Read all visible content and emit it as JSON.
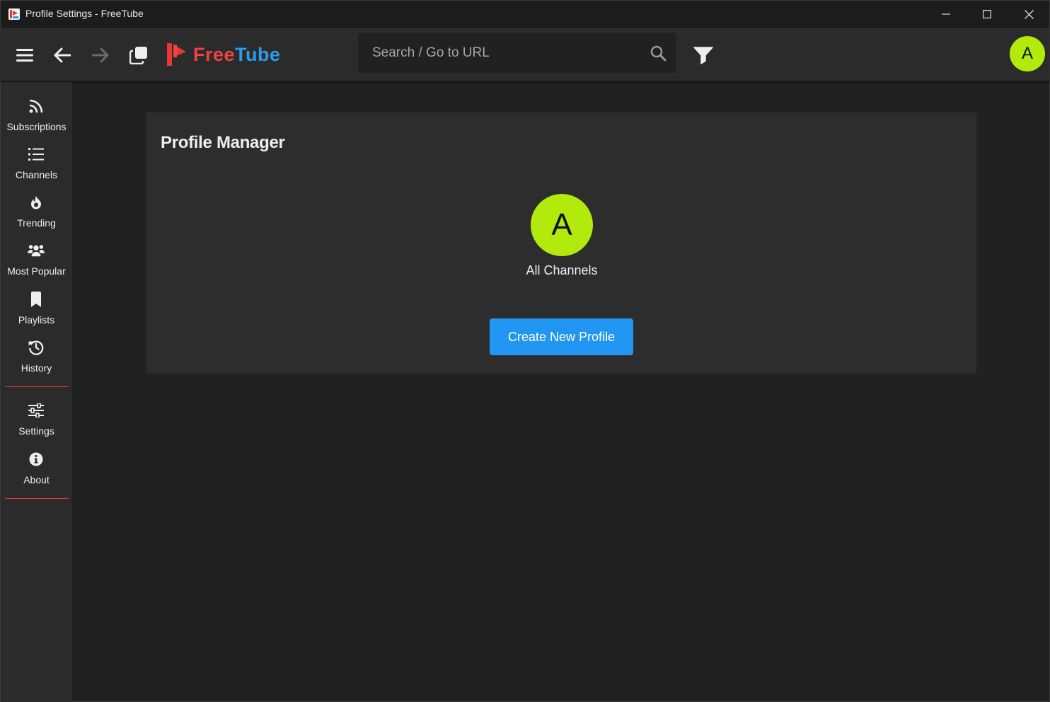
{
  "window": {
    "title": "Profile Settings - FreeTube"
  },
  "topnav": {
    "logo_free": "Free",
    "logo_tube": "Tube",
    "search_placeholder": "Search / Go to URL",
    "avatar_letter": "A"
  },
  "sidebar": {
    "items": [
      {
        "label": "Subscriptions",
        "icon": "rss-icon"
      },
      {
        "label": "Channels",
        "icon": "list-icon"
      },
      {
        "label": "Trending",
        "icon": "fire-icon"
      },
      {
        "label": "Most Popular",
        "icon": "users-icon"
      },
      {
        "label": "Playlists",
        "icon": "bookmark-icon"
      },
      {
        "label": "History",
        "icon": "history-icon"
      },
      {
        "label": "Settings",
        "icon": "sliders-icon"
      },
      {
        "label": "About",
        "icon": "info-icon"
      }
    ]
  },
  "main": {
    "title": "Profile Manager",
    "profiles": [
      {
        "letter": "A",
        "name": "All Channels",
        "color": "#b2ea0b"
      }
    ],
    "create_button": "Create New Profile"
  },
  "colors": {
    "accent_blue": "#2196f3",
    "divider_red": "#e53935",
    "avatar_green": "#b2ea0b"
  }
}
